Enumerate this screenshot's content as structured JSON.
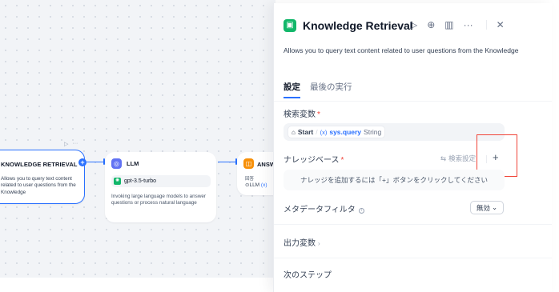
{
  "canvas": {
    "kr_node": {
      "title": "KNOWLEDGE RETRIEVAL",
      "description": "Allows you to query text content related to user questions from the Knowledge"
    },
    "llm_node": {
      "title": "LLM",
      "model": "gpt-3.5-turbo",
      "description": "Invoking large language models to answer questions or process natural language"
    },
    "answer_node": {
      "title": "ANSWER",
      "sub_label": "回答",
      "sub_value": "LLM",
      "sub_suffix": "(x)"
    },
    "toolbar": {
      "run_icon": "play-icon",
      "more_icon": "more-icon"
    }
  },
  "panel": {
    "title": "Knowledge Retrieval",
    "description": "Allows you to query text content related to user questions from the Knowledge",
    "actions": [
      "play-icon",
      "help-icon",
      "book-icon",
      "more-icon",
      "close-icon"
    ],
    "tabs": [
      {
        "label": "設定",
        "active": true
      },
      {
        "label": "最後の実行",
        "active": false
      }
    ],
    "query_variable": {
      "label": "検索変数",
      "source": "Start",
      "var_prefix": "(x)",
      "var_name": "sys.query",
      "var_type": "String"
    },
    "knowledge": {
      "label": "ナレッジベース",
      "settings_label": "検索設定",
      "empty_text": "ナレッジを追加するには「+」ボタンをクリックしてください"
    },
    "metadata_filter": {
      "label": "メタデータフィルタ",
      "value": "無効"
    },
    "output_vars": {
      "label": "出力変数"
    },
    "next_step": {
      "label": "次のステップ"
    }
  },
  "colors": {
    "accent": "#2970ff",
    "highlight": "#f04438",
    "kr_icon": "#12b76a",
    "llm_icon": "#6172f3",
    "answer_icon": "#f79009"
  }
}
